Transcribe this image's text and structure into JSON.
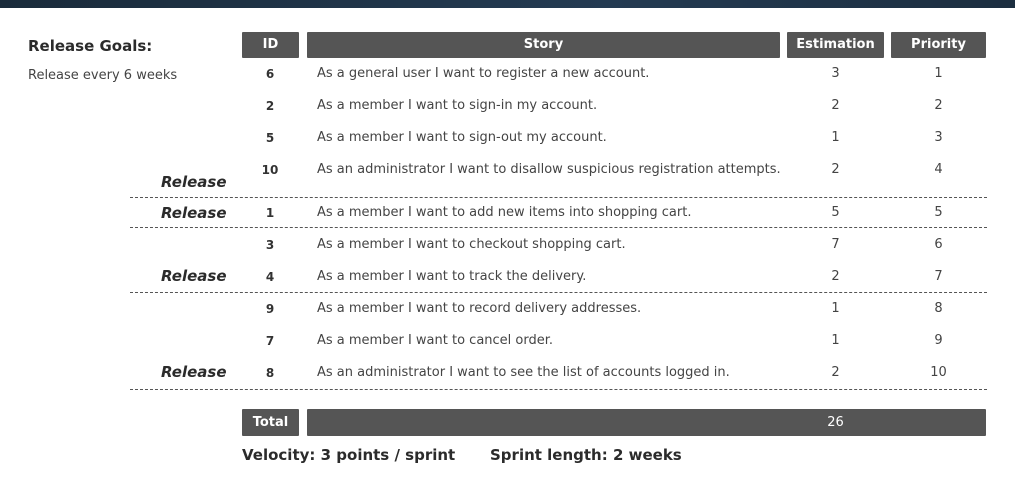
{
  "goals": {
    "title": "Release Goals:",
    "text": "Release every 6 weeks"
  },
  "headers": {
    "id": "ID",
    "story": "Story",
    "estimation": "Estimation",
    "priority": "Priority"
  },
  "rows": [
    {
      "id": "6",
      "story": "As a general user I want to register a new account.",
      "estimation": "3",
      "priority": "1"
    },
    {
      "id": "2",
      "story": "As a member I want to sign-in my account.",
      "estimation": "2",
      "priority": "2"
    },
    {
      "id": "5",
      "story": "As a member I want to sign-out my account.",
      "estimation": "1",
      "priority": "3"
    },
    {
      "id": "10",
      "story": "As an administrator I want to disallow suspicious registration attempts.",
      "estimation": "2",
      "priority": "4"
    },
    {
      "id": "1",
      "story": "As a member I want to add new items into shopping cart.",
      "estimation": "5",
      "priority": "5"
    },
    {
      "id": "3",
      "story": "As a member I want to checkout shopping cart.",
      "estimation": "7",
      "priority": "6"
    },
    {
      "id": "4",
      "story": "As a member I want to track the delivery.",
      "estimation": "2",
      "priority": "7"
    },
    {
      "id": "9",
      "story": "As a member I want to record delivery addresses.",
      "estimation": "1",
      "priority": "8"
    },
    {
      "id": "7",
      "story": "As a member I want to cancel order.",
      "estimation": "1",
      "priority": "9"
    },
    {
      "id": "8",
      "story": "As an administrator I want to see the list of accounts logged in.",
      "estimation": "2",
      "priority": "10"
    }
  ],
  "release_label": "Release",
  "total": {
    "label": "Total",
    "value": "26"
  },
  "footer": {
    "velocity": "Velocity: 3 points / sprint",
    "sprint_length": "Sprint length: 2 weeks"
  }
}
